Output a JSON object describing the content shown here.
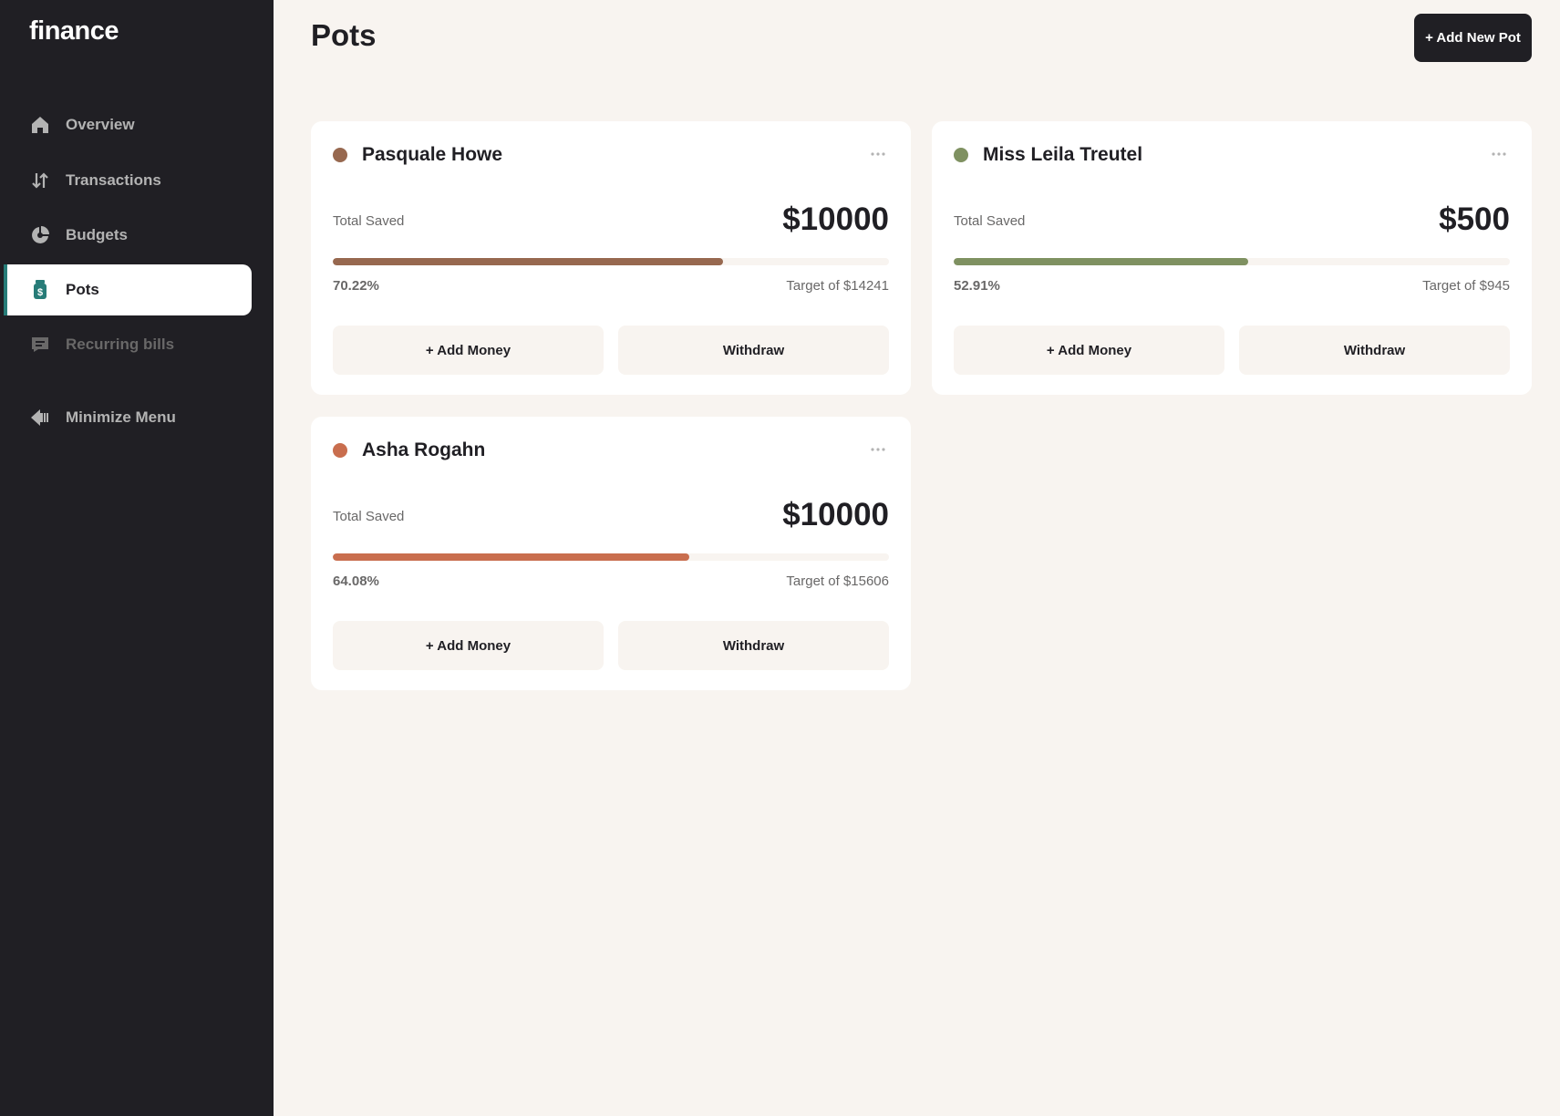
{
  "app": {
    "logo": "finance"
  },
  "sidebar": {
    "items": [
      {
        "label": "Overview",
        "icon": "home-icon"
      },
      {
        "label": "Transactions",
        "icon": "arrows-updown-icon"
      },
      {
        "label": "Budgets",
        "icon": "pie-chart-icon"
      },
      {
        "label": "Pots",
        "icon": "jar-icon",
        "active": true
      },
      {
        "label": "Recurring bills",
        "icon": "receipt-icon"
      }
    ],
    "minimize_label": "Minimize Menu"
  },
  "header": {
    "title": "Pots",
    "add_button": "+ Add New Pot"
  },
  "pots": [
    {
      "name": "Pasquale Howe",
      "color": "#97684F",
      "saved_label": "Total Saved",
      "amount": "$10000",
      "progress": 0.7022,
      "percent": "70.22%",
      "target": "Target of $14241",
      "add_label": "+ Add Money",
      "withdraw_label": "Withdraw"
    },
    {
      "name": "Miss Leila Treutel",
      "color": "#7F9161",
      "saved_label": "Total Saved",
      "amount": "$500",
      "progress": 0.5291,
      "percent": "52.91%",
      "target": "Target of $945",
      "add_label": "+ Add Money",
      "withdraw_label": "Withdraw"
    },
    {
      "name": "Asha Rogahn",
      "color": "#C96E4E",
      "saved_label": "Total Saved",
      "amount": "$10000",
      "progress": 0.6408,
      "percent": "64.08%",
      "target": "Target of $15606",
      "add_label": "+ Add Money",
      "withdraw_label": "Withdraw"
    }
  ]
}
